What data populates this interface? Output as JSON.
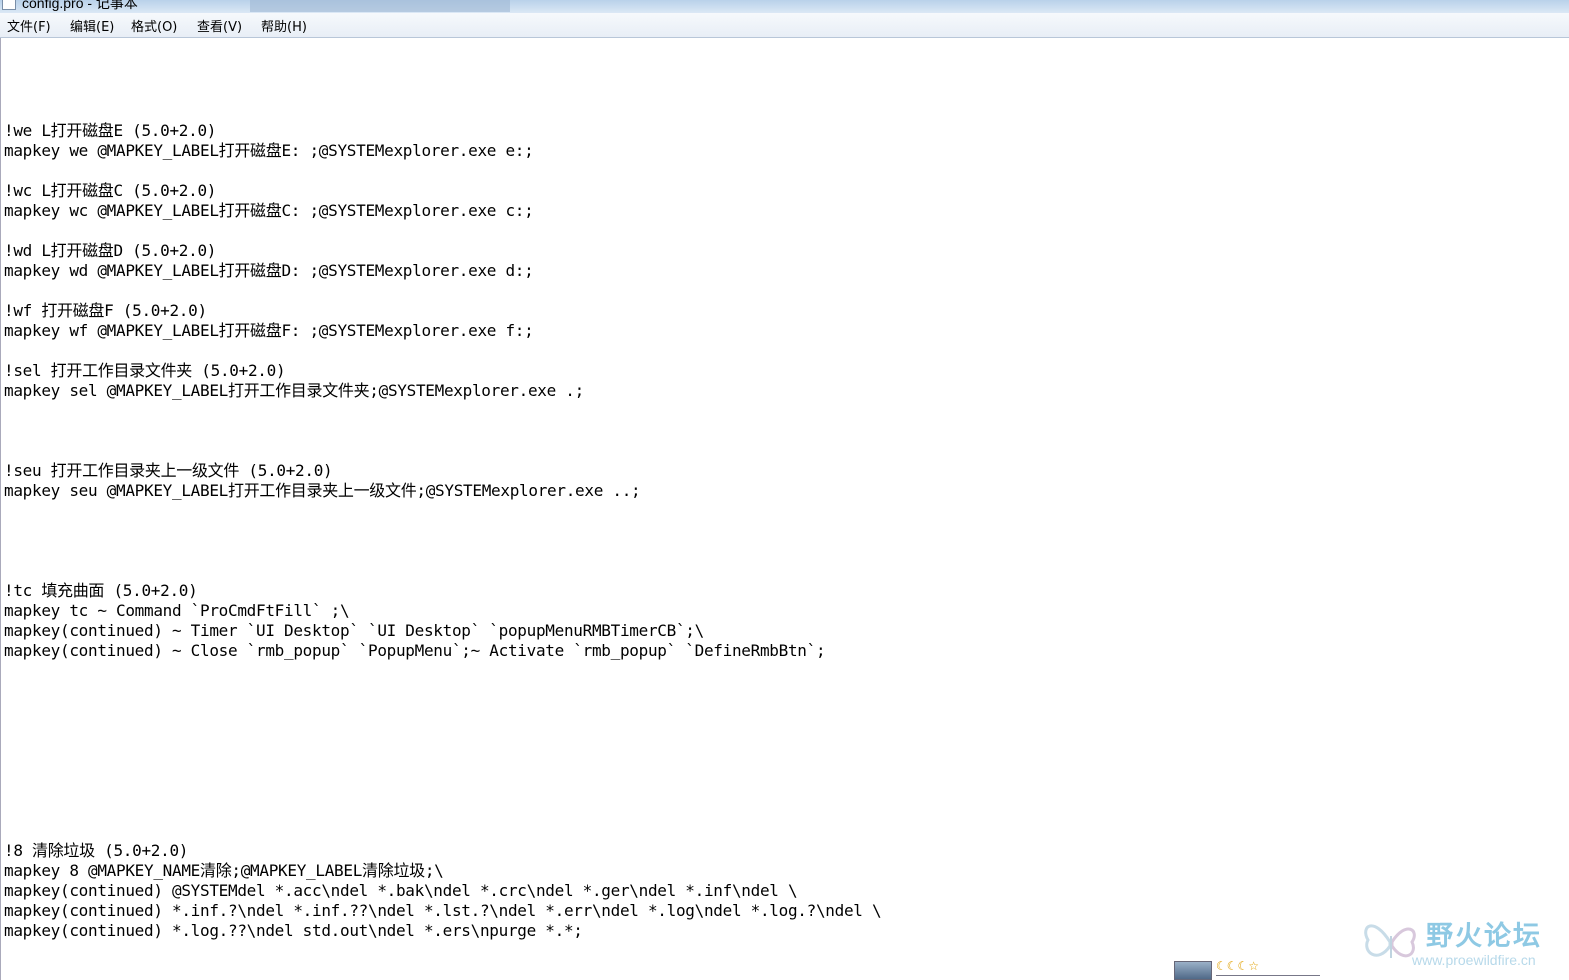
{
  "window": {
    "title": "config.pro - 记事本"
  },
  "menu": [
    "文件(F)",
    "编辑(E)",
    "格式(O)",
    "查看(V)",
    "帮助(H)"
  ],
  "lines": [
    "!we L打开磁盘E (5.0+2.0)",
    "mapkey we @MAPKEY_LABEL打开磁盘E: ;@SYSTEMexplorer.exe e:;",
    "!wc L打开磁盘C (5.0+2.0)",
    "mapkey wc @MAPKEY_LABEL打开磁盘C: ;@SYSTEMexplorer.exe c:;",
    "!wd L打开磁盘D (5.0+2.0)",
    "mapkey wd @MAPKEY_LABEL打开磁盘D: ;@SYSTEMexplorer.exe d:;",
    "!wf 打开磁盘F (5.0+2.0)",
    "mapkey wf @MAPKEY_LABEL打开磁盘F: ;@SYSTEMexplorer.exe f:;",
    "!sel 打开工作目录文件夹 (5.0+2.0)",
    "mapkey sel @MAPKEY_LABEL打开工作目录文件夹;@SYSTEMexplorer.exe .;",
    "!seu 打开工作目录夹上一级文件 (5.0+2.0)",
    "mapkey seu @MAPKEY_LABEL打开工作目录夹上一级文件;@SYSTEMexplorer.exe ..;",
    "!tc 填充曲面 (5.0+2.0)",
    "mapkey tc ~ Command `ProCmdFtFill` ;\\",
    "mapkey(continued) ~ Timer `UI Desktop` `UI Desktop` `popupMenuRMBTimerCB`;\\",
    "mapkey(continued) ~ Close `rmb_popup` `PopupMenu`;~ Activate `rmb_popup` `DefineRmbBtn`;",
    "!8 清除垃圾 (5.0+2.0)",
    "mapkey 8 @MAPKEY_NAME清除;@MAPKEY_LABEL清除垃圾;\\",
    "mapkey(continued) @SYSTEMdel *.acc\\ndel *.bak\\ndel *.crc\\ndel *.ger\\ndel *.inf\\ndel \\",
    "mapkey(continued) *.inf.?\\ndel *.inf.??\\ndel *.lst.?\\ndel *.err\\ndel *.log\\ndel *.log.?\\ndel \\",
    "mapkey(continued) *.log.??\\ndel std.out\\ndel *.ers\\npurge *.*;"
  ],
  "watermark": {
    "text": "野火论坛",
    "url": "www.proewildfire.cn"
  },
  "avatar_rank": "☾☾☾☆"
}
